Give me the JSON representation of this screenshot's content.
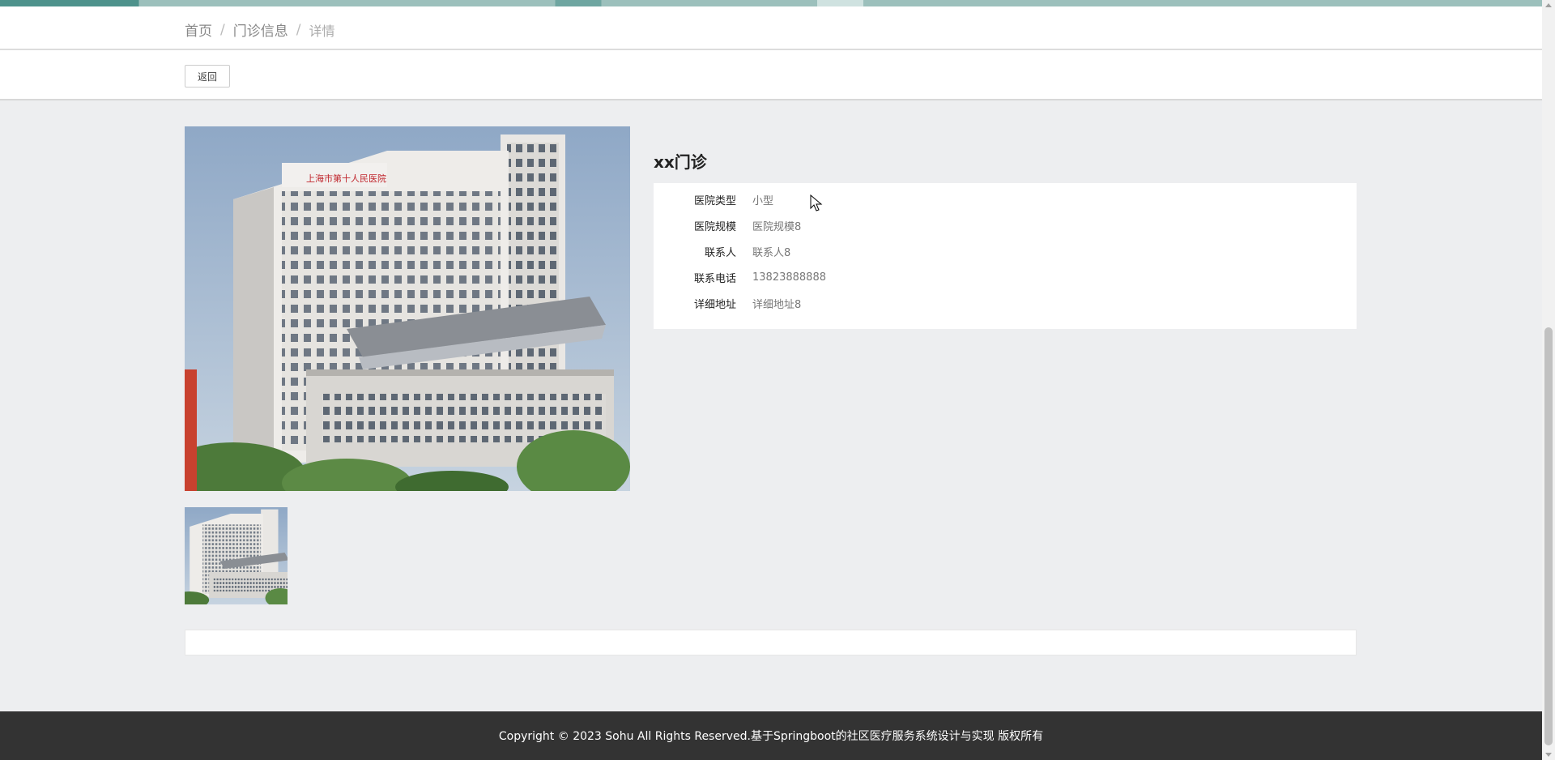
{
  "breadcrumb": {
    "home": "首页",
    "section": "门诊信息",
    "current": "详情",
    "separator": "/"
  },
  "actions": {
    "back_label": "返回"
  },
  "clinic": {
    "name": "xx门诊",
    "fields": [
      {
        "label": "医院类型",
        "value": "小型"
      },
      {
        "label": "医院规模",
        "value": "医院规模8"
      },
      {
        "label": "联系人",
        "value": "联系人8"
      },
      {
        "label": "联系电话",
        "value": "13823888888"
      },
      {
        "label": "详细地址",
        "value": "详细地址8"
      }
    ]
  },
  "images": {
    "main_icon": "hospital-building-photo",
    "thumb_icon": "hospital-building-thumbnail",
    "sign_text": "上海市第十人民医院"
  },
  "footer": {
    "copyright": "Copyright © 2023 Sohu All Rights Reserved.基于Springboot的社区医疗服务系统设计与实现 版权所有"
  },
  "colors": {
    "accent": "#4e928c",
    "footer_bg": "#333333",
    "page_bg": "#edeef0"
  }
}
